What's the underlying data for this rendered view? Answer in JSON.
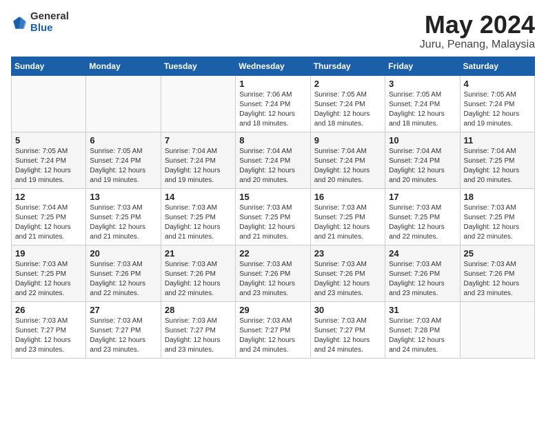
{
  "header": {
    "logo_general": "General",
    "logo_blue": "Blue",
    "title": "May 2024",
    "subtitle": "Juru, Penang, Malaysia"
  },
  "weekdays": [
    "Sunday",
    "Monday",
    "Tuesday",
    "Wednesday",
    "Thursday",
    "Friday",
    "Saturday"
  ],
  "weeks": [
    [
      {
        "day": "",
        "info": ""
      },
      {
        "day": "",
        "info": ""
      },
      {
        "day": "",
        "info": ""
      },
      {
        "day": "1",
        "info": "Sunrise: 7:06 AM\nSunset: 7:24 PM\nDaylight: 12 hours\nand 18 minutes."
      },
      {
        "day": "2",
        "info": "Sunrise: 7:05 AM\nSunset: 7:24 PM\nDaylight: 12 hours\nand 18 minutes."
      },
      {
        "day": "3",
        "info": "Sunrise: 7:05 AM\nSunset: 7:24 PM\nDaylight: 12 hours\nand 18 minutes."
      },
      {
        "day": "4",
        "info": "Sunrise: 7:05 AM\nSunset: 7:24 PM\nDaylight: 12 hours\nand 19 minutes."
      }
    ],
    [
      {
        "day": "5",
        "info": "Sunrise: 7:05 AM\nSunset: 7:24 PM\nDaylight: 12 hours\nand 19 minutes."
      },
      {
        "day": "6",
        "info": "Sunrise: 7:05 AM\nSunset: 7:24 PM\nDaylight: 12 hours\nand 19 minutes."
      },
      {
        "day": "7",
        "info": "Sunrise: 7:04 AM\nSunset: 7:24 PM\nDaylight: 12 hours\nand 19 minutes."
      },
      {
        "day": "8",
        "info": "Sunrise: 7:04 AM\nSunset: 7:24 PM\nDaylight: 12 hours\nand 20 minutes."
      },
      {
        "day": "9",
        "info": "Sunrise: 7:04 AM\nSunset: 7:24 PM\nDaylight: 12 hours\nand 20 minutes."
      },
      {
        "day": "10",
        "info": "Sunrise: 7:04 AM\nSunset: 7:24 PM\nDaylight: 12 hours\nand 20 minutes."
      },
      {
        "day": "11",
        "info": "Sunrise: 7:04 AM\nSunset: 7:25 PM\nDaylight: 12 hours\nand 20 minutes."
      }
    ],
    [
      {
        "day": "12",
        "info": "Sunrise: 7:04 AM\nSunset: 7:25 PM\nDaylight: 12 hours\nand 21 minutes."
      },
      {
        "day": "13",
        "info": "Sunrise: 7:03 AM\nSunset: 7:25 PM\nDaylight: 12 hours\nand 21 minutes."
      },
      {
        "day": "14",
        "info": "Sunrise: 7:03 AM\nSunset: 7:25 PM\nDaylight: 12 hours\nand 21 minutes."
      },
      {
        "day": "15",
        "info": "Sunrise: 7:03 AM\nSunset: 7:25 PM\nDaylight: 12 hours\nand 21 minutes."
      },
      {
        "day": "16",
        "info": "Sunrise: 7:03 AM\nSunset: 7:25 PM\nDaylight: 12 hours\nand 21 minutes."
      },
      {
        "day": "17",
        "info": "Sunrise: 7:03 AM\nSunset: 7:25 PM\nDaylight: 12 hours\nand 22 minutes."
      },
      {
        "day": "18",
        "info": "Sunrise: 7:03 AM\nSunset: 7:25 PM\nDaylight: 12 hours\nand 22 minutes."
      }
    ],
    [
      {
        "day": "19",
        "info": "Sunrise: 7:03 AM\nSunset: 7:25 PM\nDaylight: 12 hours\nand 22 minutes."
      },
      {
        "day": "20",
        "info": "Sunrise: 7:03 AM\nSunset: 7:26 PM\nDaylight: 12 hours\nand 22 minutes."
      },
      {
        "day": "21",
        "info": "Sunrise: 7:03 AM\nSunset: 7:26 PM\nDaylight: 12 hours\nand 22 minutes."
      },
      {
        "day": "22",
        "info": "Sunrise: 7:03 AM\nSunset: 7:26 PM\nDaylight: 12 hours\nand 23 minutes."
      },
      {
        "day": "23",
        "info": "Sunrise: 7:03 AM\nSunset: 7:26 PM\nDaylight: 12 hours\nand 23 minutes."
      },
      {
        "day": "24",
        "info": "Sunrise: 7:03 AM\nSunset: 7:26 PM\nDaylight: 12 hours\nand 23 minutes."
      },
      {
        "day": "25",
        "info": "Sunrise: 7:03 AM\nSunset: 7:26 PM\nDaylight: 12 hours\nand 23 minutes."
      }
    ],
    [
      {
        "day": "26",
        "info": "Sunrise: 7:03 AM\nSunset: 7:27 PM\nDaylight: 12 hours\nand 23 minutes."
      },
      {
        "day": "27",
        "info": "Sunrise: 7:03 AM\nSunset: 7:27 PM\nDaylight: 12 hours\nand 23 minutes."
      },
      {
        "day": "28",
        "info": "Sunrise: 7:03 AM\nSunset: 7:27 PM\nDaylight: 12 hours\nand 23 minutes."
      },
      {
        "day": "29",
        "info": "Sunrise: 7:03 AM\nSunset: 7:27 PM\nDaylight: 12 hours\nand 24 minutes."
      },
      {
        "day": "30",
        "info": "Sunrise: 7:03 AM\nSunset: 7:27 PM\nDaylight: 12 hours\nand 24 minutes."
      },
      {
        "day": "31",
        "info": "Sunrise: 7:03 AM\nSunset: 7:28 PM\nDaylight: 12 hours\nand 24 minutes."
      },
      {
        "day": "",
        "info": ""
      }
    ]
  ]
}
